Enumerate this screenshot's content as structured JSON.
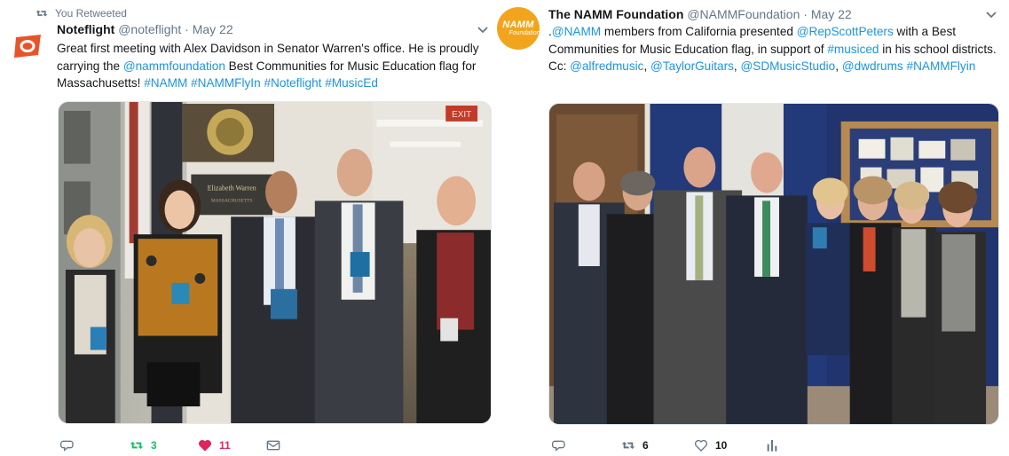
{
  "tweets": [
    {
      "retweet_notice": "You Retweeted",
      "name": "Noteflight",
      "handle": "@noteflight",
      "date": "May 22",
      "text_parts": [
        {
          "t": "Great first meeting with Alex Davidson in Senator Warren's office. He is proudly carrying the ",
          "link": false
        },
        {
          "t": "@nammfoundation",
          "link": true
        },
        {
          "t": " Best Communities for Music Education flag for Massachusetts! ",
          "link": false
        },
        {
          "t": "#NAMM",
          "link": true
        },
        {
          "t": " ",
          "link": false
        },
        {
          "t": "#NAMMFlyIn",
          "link": true
        },
        {
          "t": " ",
          "link": false
        },
        {
          "t": "#Noteflight",
          "link": true
        },
        {
          "t": " ",
          "link": false
        },
        {
          "t": "#MusicEd",
          "link": true
        }
      ],
      "photo_sign": "Elizabeth Warren",
      "photo_sign_sub": "MASSACHUSETTS",
      "photo_exit": "EXIT",
      "actions": {
        "reply": "",
        "retweet": "3",
        "like": "11",
        "dm": ""
      },
      "retweeted": true,
      "liked": true,
      "icons": {
        "retweet_notice": "retweet-icon",
        "avatar": "noteflight-logo-icon",
        "caret": "chevron-down-icon"
      }
    },
    {
      "name": "The NAMM Foundation",
      "handle": "@NAMMFoundation",
      "date": "May 22",
      "avatar_text": "NAMM",
      "avatar_sub": "Foundation",
      "text_parts": [
        {
          "t": ".",
          "link": false
        },
        {
          "t": "@NAMM",
          "link": true
        },
        {
          "t": " members from California presented ",
          "link": false
        },
        {
          "t": "@RepScottPeters",
          "link": true
        },
        {
          "t": " with a Best Communities for Music Education flag, in support of ",
          "link": false
        },
        {
          "t": "#musiced",
          "link": true
        },
        {
          "t": " in his school districts. Cc: ",
          "link": false
        },
        {
          "t": "@alfredmusic",
          "link": true
        },
        {
          "t": ", ",
          "link": false
        },
        {
          "t": "@TaylorGuitars",
          "link": true
        },
        {
          "t": ", ",
          "link": false
        },
        {
          "t": "@SDMusicStudio",
          "link": true
        },
        {
          "t": ", ",
          "link": false
        },
        {
          "t": "@dwdrums",
          "link": true
        },
        {
          "t": " ",
          "link": false
        },
        {
          "t": "#NAMMFlyin",
          "link": true
        }
      ],
      "actions": {
        "reply": "",
        "retweet": "6",
        "like": "10",
        "analytics": ""
      },
      "retweeted": false,
      "liked": false,
      "icons": {
        "caret": "chevron-down-icon"
      }
    }
  ],
  "colors": {
    "link": "#1b95e0",
    "muted": "#657786",
    "retweet": "#17bf63",
    "like": "#e0245e",
    "noteflight": "#e8542a",
    "namm": "#f2a51c"
  }
}
